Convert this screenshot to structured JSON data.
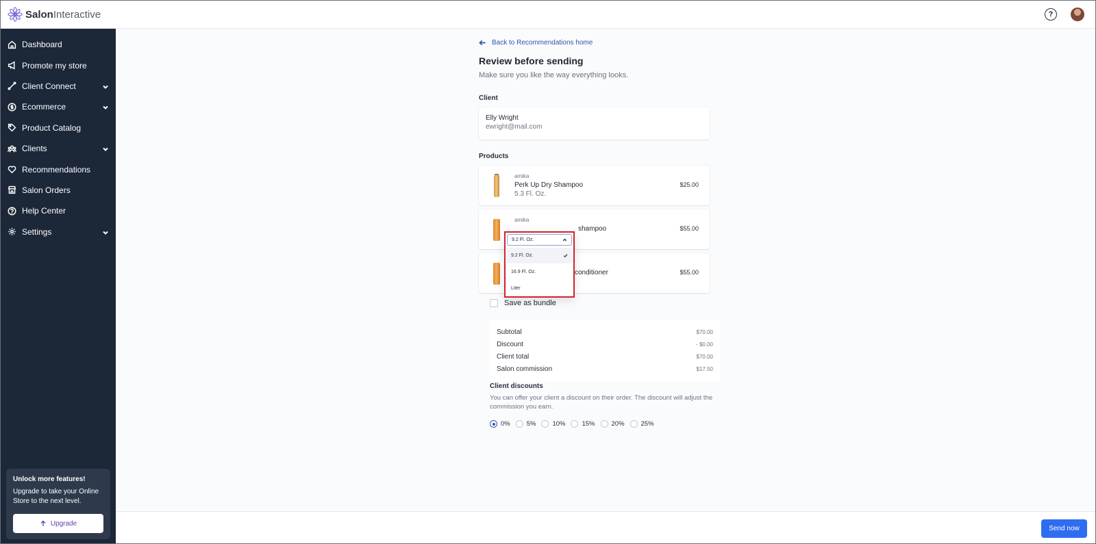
{
  "app": {
    "logo_bold": "Salon",
    "logo_rest": "Interactive"
  },
  "sidebar": {
    "items": [
      {
        "label": "Dashboard",
        "icon": "home-icon"
      },
      {
        "label": "Promote my store",
        "icon": "megaphone-icon"
      },
      {
        "label": "Client Connect",
        "icon": "connect-icon",
        "expandable": true
      },
      {
        "label": "Ecommerce",
        "icon": "dollar-icon",
        "expandable": true
      },
      {
        "label": "Product Catalog",
        "icon": "tag-icon"
      },
      {
        "label": "Clients",
        "icon": "users-icon",
        "expandable": true
      },
      {
        "label": "Recommendations",
        "icon": "heart-icon"
      },
      {
        "label": "Salon Orders",
        "icon": "store-icon"
      },
      {
        "label": "Help Center",
        "icon": "help-circle-icon"
      },
      {
        "label": "Settings",
        "icon": "gear-icon",
        "expandable": true
      }
    ],
    "upgrade": {
      "title": "Unlock more features!",
      "body": "Upgrade to take your Online Store to the next level.",
      "button": "Upgrade"
    }
  },
  "page": {
    "back_link": "Back to Recommendations home",
    "title": "Review before sending",
    "subtitle": "Make sure you like the way everything looks.",
    "client_label": "Client",
    "client": {
      "name": "Elly Wright",
      "email": "ewright@mail.com"
    },
    "products_label": "Products",
    "products": [
      {
        "brand": "amika",
        "name": "Perk Up Dry Shampoo",
        "size": "5.3 Fl. Oz.",
        "price": "$25.00"
      },
      {
        "brand": "amika",
        "name": "shampoo",
        "price": "$55.00"
      },
      {
        "brand": "",
        "name": "conditioner",
        "price": "$55.00"
      }
    ],
    "size_dropdown": {
      "value": "9.2 Fl. Oz.",
      "options": [
        "9.2 Fl. Oz.",
        "16.9 Fl. Oz.",
        "Liter"
      ],
      "selected_index": 0
    },
    "bundle_label": "Save as bundle",
    "totals": [
      {
        "label": "Subtotal",
        "value": "$70.00"
      },
      {
        "label": "Discount",
        "value": "- $0.00"
      },
      {
        "label": "Client total",
        "value": "$70.00"
      },
      {
        "label": "Salon commission",
        "value": "$17.50"
      }
    ],
    "discounts": {
      "title": "Client discounts",
      "text": "You can offer your client a discount on their order. The discount will adjust the commission you earn.",
      "options": [
        "0%",
        "5%",
        "10%",
        "15%",
        "20%",
        "25%"
      ],
      "selected": "0%"
    }
  },
  "footer": {
    "send_button": "Send now"
  },
  "colors": {
    "sidebar_bg": "#1c2738",
    "primary": "#2f6df0",
    "link": "#2f55a8",
    "highlight_border": "#d4202c"
  }
}
